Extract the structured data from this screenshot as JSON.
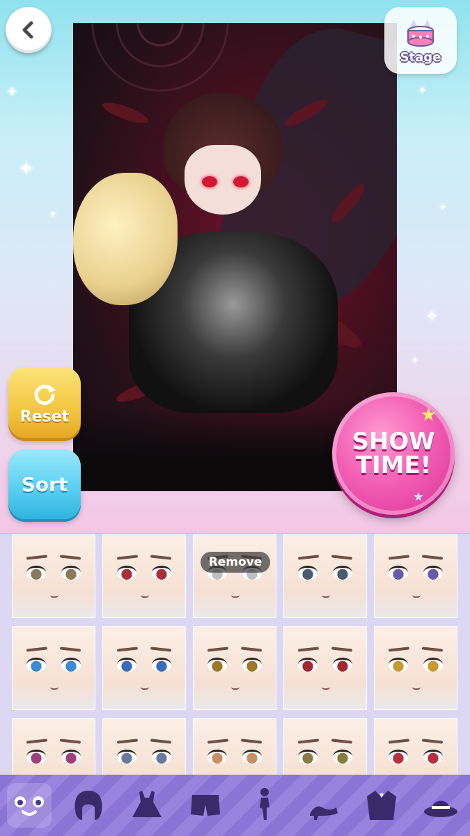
{
  "header": {
    "stage_label": "Stage"
  },
  "actions": {
    "reset_label": "Reset",
    "sort_label": "Sort",
    "showtime_line1": "SHOW",
    "showtime_line2": "TIME!"
  },
  "faces": {
    "remove_label": "Remove",
    "items": [
      {
        "eye_color": "#8a7a5a"
      },
      {
        "eye_color": "#a8303a"
      },
      {
        "eye_color": "#c0c0c0",
        "remove": true
      },
      {
        "eye_color": "#4a5a70"
      },
      {
        "eye_color": "#6a5aa8"
      },
      {
        "eye_color": "#3c8ad0"
      },
      {
        "eye_color": "#3a6ab8"
      },
      {
        "eye_color": "#a0782a"
      },
      {
        "eye_color": "#a02a30"
      },
      {
        "eye_color": "#c89a30"
      },
      {
        "eye_color": "#a0407a"
      },
      {
        "eye_color": "#6a7a9a"
      },
      {
        "eye_color": "#c89060"
      },
      {
        "eye_color": "#8a7a40"
      },
      {
        "eye_color": "#b83040"
      }
    ]
  },
  "categories": [
    {
      "icon": "face-icon",
      "active": true
    },
    {
      "icon": "hair-icon"
    },
    {
      "icon": "dress-icon"
    },
    {
      "icon": "shorts-icon"
    },
    {
      "icon": "pose-icon"
    },
    {
      "icon": "heels-icon"
    },
    {
      "icon": "jacket-icon"
    },
    {
      "icon": "hat-icon"
    }
  ],
  "colors": {
    "accent_pink": "#f35fb5",
    "reset_yellow": "#f3c640",
    "sort_blue": "#56cdf0",
    "category_purple": "#8c73d6"
  }
}
